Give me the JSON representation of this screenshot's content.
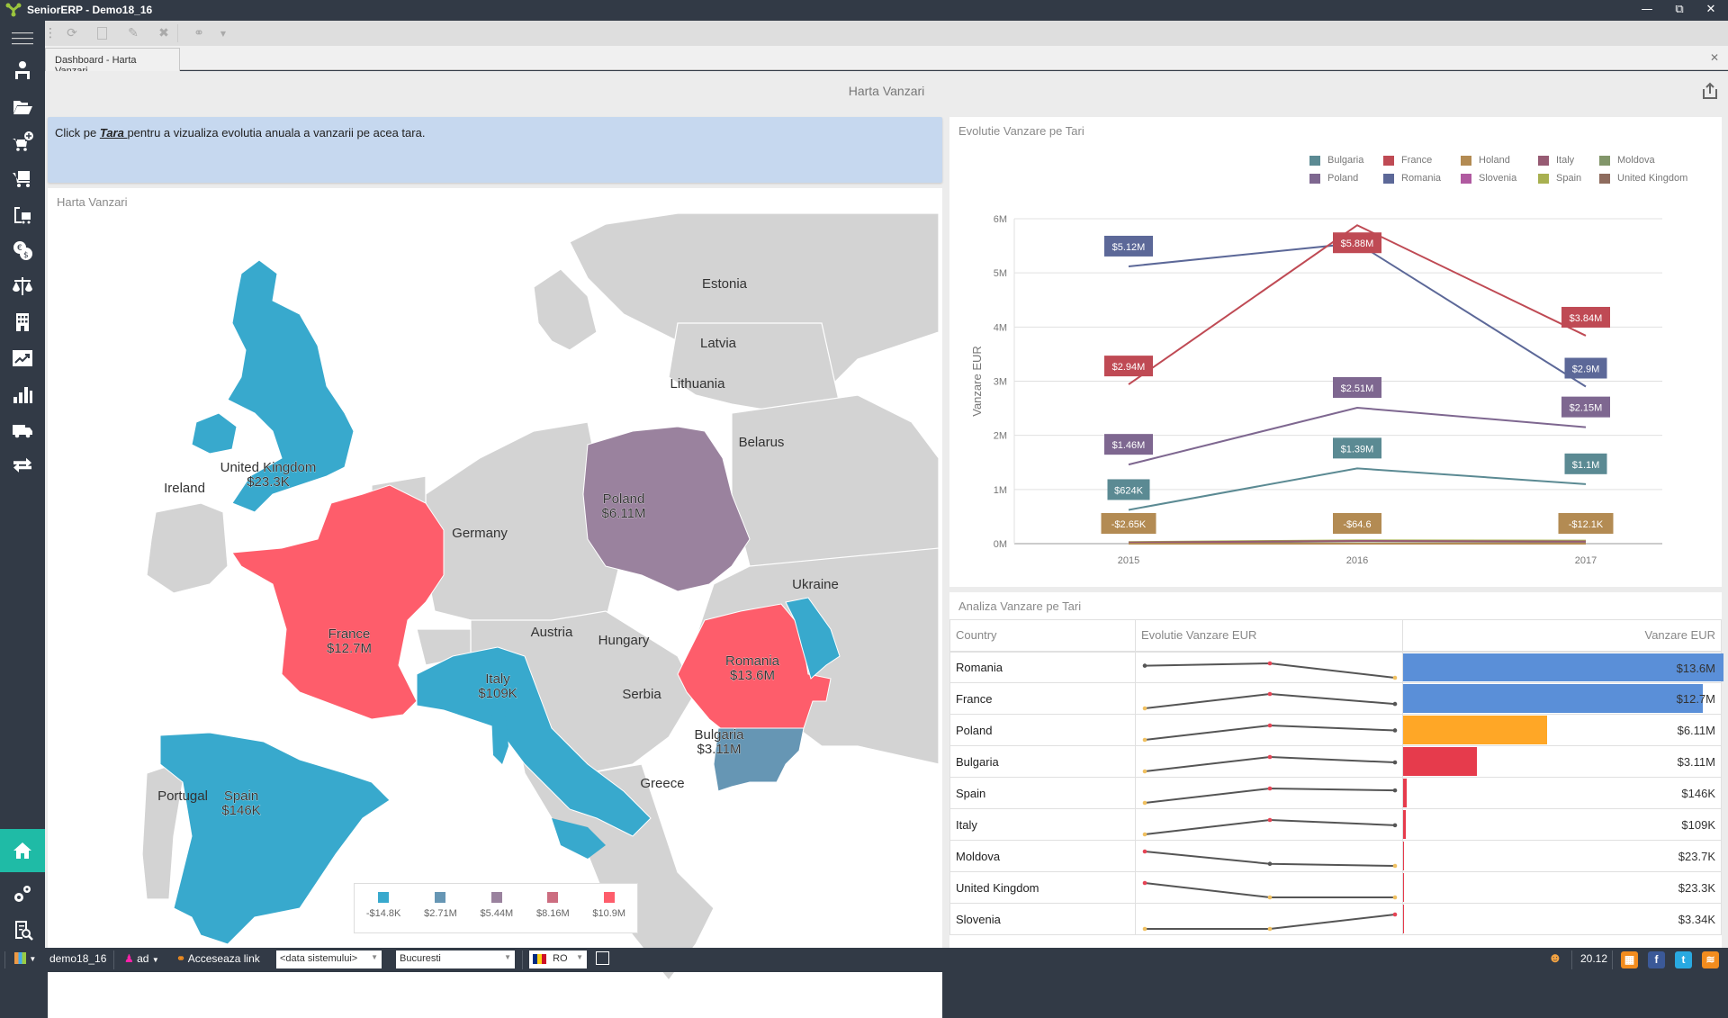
{
  "app": {
    "title": "SeniorERP - Demo18_16",
    "window_buttons": [
      "minimize",
      "restore",
      "close"
    ]
  },
  "toolbar": {
    "items": [
      "refresh-icon",
      "new-icon",
      "edit-icon",
      "delete-icon",
      "link-icon",
      "dropdown-icon"
    ]
  },
  "tabs": [
    {
      "label": "Dashboard - Harta Vanzari",
      "active": true
    }
  ],
  "sidebar": {
    "items": [
      {
        "icon": "menu-icon"
      },
      {
        "icon": "user-desk-icon"
      },
      {
        "icon": "folder-open-icon"
      },
      {
        "icon": "cart-add-icon"
      },
      {
        "icon": "cart-icon"
      },
      {
        "icon": "clipboard-cart-icon"
      },
      {
        "icon": "currency-icon"
      },
      {
        "icon": "balance-scale-icon"
      },
      {
        "icon": "building-icon"
      },
      {
        "icon": "trend-chart-icon"
      },
      {
        "icon": "bar-chart-icon"
      },
      {
        "icon": "truck-icon"
      },
      {
        "icon": "transfer-arrows-icon"
      },
      {
        "icon": "home-icon",
        "active": true
      },
      {
        "icon": "settings-gears-icon"
      },
      {
        "icon": "report-search-icon"
      }
    ]
  },
  "page": {
    "title": "Harta Vanzari",
    "banner": {
      "prefix": "Click pe ",
      "link": "Tara ",
      "suffix": "pentru a vizualiza evolutia anuala a vanzarii pe acea tara."
    }
  },
  "map": {
    "title": "Harta Vanzari",
    "regions": [
      {
        "name": "United Kingdom",
        "value": "$23.3K",
        "color": "#38a9cd"
      },
      {
        "name": "France",
        "value": "$12.7M",
        "color": "#fe5d6b"
      },
      {
        "name": "Spain",
        "value": "$146K",
        "color": "#38a9cd"
      },
      {
        "name": "Italy",
        "value": "$109K",
        "color": "#38a9cd"
      },
      {
        "name": "Poland",
        "value": "$6.11M",
        "color": "#9a829e"
      },
      {
        "name": "Romania",
        "value": "$13.6M",
        "color": "#fe5d6b"
      },
      {
        "name": "Bulgaria",
        "value": "$3.11M",
        "color": "#6696b4"
      },
      {
        "name": "Moldova",
        "value": "",
        "color": "#38a9cd"
      }
    ],
    "labels": [
      "Estonia",
      "Latvia",
      "Lithuania",
      "Belarus",
      "Ireland",
      "Germany",
      "Ukraine",
      "Austria",
      "Hungary",
      "Serbia",
      "Portugal",
      "Greece"
    ],
    "legend": [
      {
        "label": "-$14.8K",
        "color": "#38a9cd"
      },
      {
        "label": "$2.71M",
        "color": "#6696b4"
      },
      {
        "label": "$5.44M",
        "color": "#9a829e"
      },
      {
        "label": "$8.16M",
        "color": "#cc6d80"
      },
      {
        "label": "$10.9M",
        "color": "#fe5d6b"
      }
    ]
  },
  "chart_data": {
    "type": "line",
    "title": "Evolutie Vanzare pe Tari",
    "xlabel": "",
    "ylabel": "Vanzare EUR",
    "x": [
      "2015",
      "2016",
      "2017"
    ],
    "yticks": [
      "0M",
      "1M",
      "2M",
      "3M",
      "4M",
      "5M",
      "6M"
    ],
    "ylim": [
      0,
      6000000
    ],
    "grid": true,
    "legend_position": "top-right",
    "series": [
      {
        "name": "Bulgaria",
        "color": "#5b8a93",
        "values": [
          624000,
          1390000,
          1100000
        ],
        "labels": [
          "$624K",
          "$1.39M",
          "$1.1M"
        ]
      },
      {
        "name": "France",
        "color": "#bf4a54",
        "values": [
          2940000,
          5880000,
          3840000
        ],
        "labels": [
          "$2.94M",
          "$5.88M",
          "$3.84M"
        ]
      },
      {
        "name": "Holand",
        "color": "#b38b53",
        "values": [
          -2650,
          -64.6,
          -12100
        ],
        "labels": [
          "-$2.65K",
          "-$64.6",
          "-$12.1K"
        ]
      },
      {
        "name": "Italy",
        "color": "#975b73",
        "values": [
          20000,
          50000,
          39000
        ],
        "labels": [
          "",
          "",
          ""
        ]
      },
      {
        "name": "Moldova",
        "color": "#82966a",
        "values": [
          12000,
          6000,
          5000
        ],
        "labels": [
          "",
          "",
          ""
        ]
      },
      {
        "name": "Poland",
        "color": "#7e6790",
        "values": [
          1460000,
          2510000,
          2150000
        ],
        "labels": [
          "$1.46M",
          "$2.51M",
          "$2.15M"
        ]
      },
      {
        "name": "Romania",
        "color": "#5c6898",
        "values": [
          5120000,
          5550000,
          2900000
        ],
        "labels": [
          "$5.12M",
          "",
          "$2.9M"
        ]
      },
      {
        "name": "Slovenia",
        "color": "#b05aa0",
        "values": [
          500,
          500,
          2340
        ],
        "labels": [
          "",
          "",
          ""
        ]
      },
      {
        "name": "Spain",
        "color": "#a8b050",
        "values": [
          30000,
          60000,
          56000
        ],
        "labels": [
          "",
          "",
          ""
        ]
      },
      {
        "name": "United Kingdom",
        "color": "#8e6c5e",
        "values": [
          12000,
          5600,
          5600
        ],
        "labels": [
          "",
          "",
          ""
        ]
      }
    ]
  },
  "grid": {
    "title": "Analiza Vanzare pe Tari",
    "columns": [
      "Country",
      "Evolutie Vanzare EUR",
      "Vanzare EUR"
    ],
    "rows": [
      {
        "country": "Romania",
        "spark": [
          5.12,
          5.55,
          2.9
        ],
        "value": "$13.6M",
        "pct": 1.0,
        "bar_color": "#5a8fd8"
      },
      {
        "country": "France",
        "spark": [
          2.94,
          5.88,
          3.84
        ],
        "value": "$12.7M",
        "pct": 0.934,
        "bar_color": "#5a8fd8"
      },
      {
        "country": "Poland",
        "spark": [
          1.46,
          2.51,
          2.15
        ],
        "value": "$6.11M",
        "pct": 0.449,
        "bar_color": "#ffa726"
      },
      {
        "country": "Bulgaria",
        "spark": [
          0.624,
          1.39,
          1.1
        ],
        "value": "$3.11M",
        "pct": 0.229,
        "bar_color": "#e63b4c"
      },
      {
        "country": "Spain",
        "spark": [
          0.03,
          0.06,
          0.056
        ],
        "value": "$146K",
        "pct": 0.011,
        "bar_color": "#e63b4c"
      },
      {
        "country": "Italy",
        "spark": [
          0.02,
          0.05,
          0.039
        ],
        "value": "$109K",
        "pct": 0.008,
        "bar_color": "#e63b4c"
      },
      {
        "country": "Moldova",
        "spark": [
          0.012,
          0.006,
          0.005
        ],
        "value": "$23.7K",
        "pct": 0.0017,
        "bar_color": "#e63b4c"
      },
      {
        "country": "United Kingdom",
        "spark": [
          0.012,
          0.0056,
          0.0056
        ],
        "value": "$23.3K",
        "pct": 0.0017,
        "bar_color": "#e63b4c"
      },
      {
        "country": "Slovenia",
        "spark": [
          0.0005,
          0.0005,
          0.00234
        ],
        "value": "$3.34K",
        "pct": 0.0002,
        "bar_color": "#e63b4c"
      }
    ]
  },
  "statusbar": {
    "db": "demo18_16",
    "user": "ad",
    "link_label": "Acceseaza link",
    "date_select": "<data sistemului>",
    "city_select": "Bucuresti",
    "lang_select": "RO",
    "time": "20.12"
  }
}
